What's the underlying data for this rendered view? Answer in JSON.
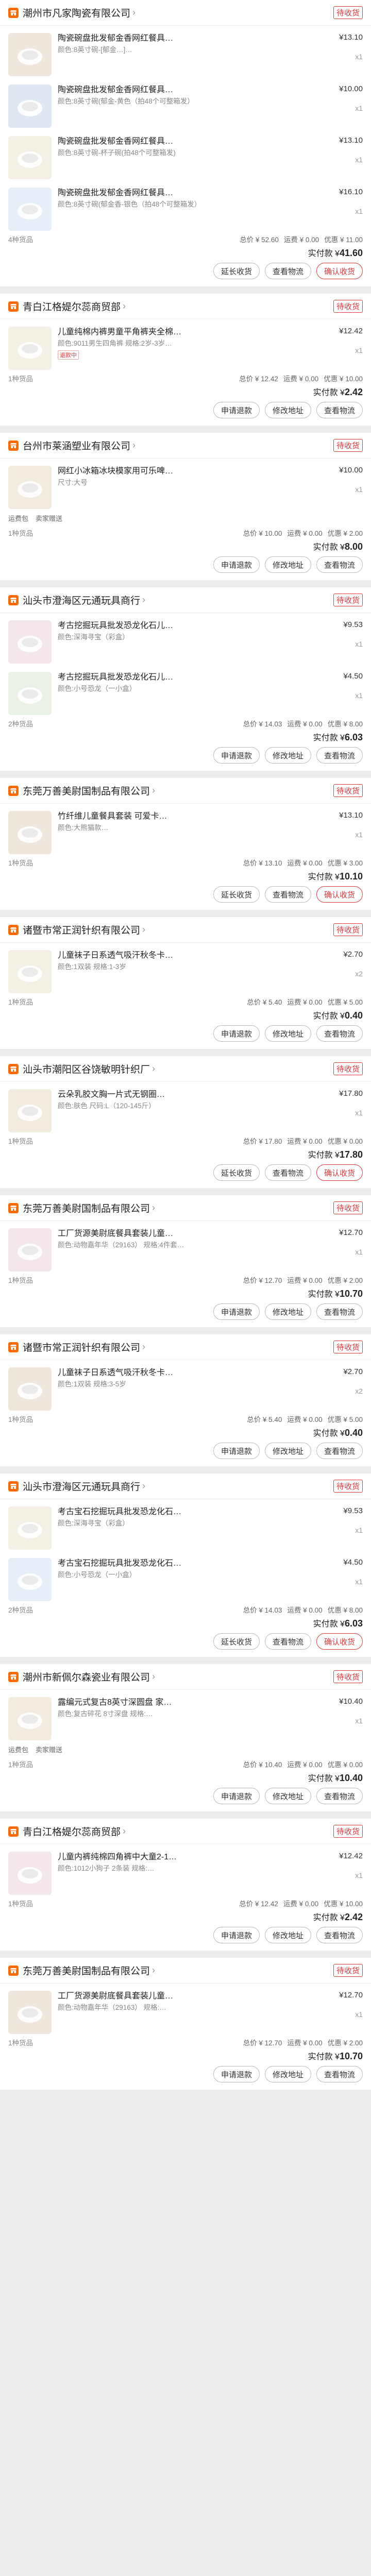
{
  "orders": [
    {
      "shop": "潮州市凡家陶瓷有限公司",
      "status": "待收货",
      "items": [
        {
          "title": "陶瓷碗盘批发郁金香网红餐具…",
          "spec": "颜色:8英寸碗-[郁金…]…",
          "price": "¥13.10",
          "qty": "x1"
        },
        {
          "title": "陶瓷碗盘批发郁金香网红餐具…",
          "spec": "颜色:8英寸碗(郁金-黄色（拍48个可整箱发）",
          "price": "¥10.00",
          "qty": "x1"
        },
        {
          "title": "陶瓷碗盘批发郁金香网红餐具…",
          "spec": "颜色:8英寸碗-杯子碗(拍48个可整箱发)",
          "price": "¥13.10",
          "qty": "x1"
        },
        {
          "title": "陶瓷碗盘批发郁金香网红餐具…",
          "spec": "颜色:8英寸碗(郁金香-银色（拍48个可整箱发）",
          "price": "¥16.10",
          "qty": "x1"
        }
      ],
      "count": "4种货品",
      "total": "总价 ¥ 52.60",
      "ship": "运费 ¥ 0.00",
      "discount": "优惠 ¥ 11.00",
      "paid_label": "实付款 ¥",
      "paid": "41.60",
      "buttons": [
        "延长收货",
        "查看物流",
        "确认收货"
      ]
    },
    {
      "shop": "青白江格媞尔蕊商贸部",
      "status": "待收货",
      "items": [
        {
          "title": "儿童纯棉内裤男童平角裤夹全棉…",
          "spec": "颜色:9011男生四角裤 规格:2岁-3岁…",
          "price": "¥12.42",
          "qty": "x1",
          "tag": "退款中"
        }
      ],
      "count": "1种货品",
      "total": "总价 ¥ 12.42",
      "ship": "运费 ¥ 0.00",
      "discount": "优惠 ¥ 10.00",
      "paid_label": "实付款 ¥",
      "paid": "2.42",
      "buttons": [
        "申请退款",
        "修改地址",
        "查看物流"
      ]
    },
    {
      "shop": "台州市莱涵塑业有限公司",
      "status": "待收货",
      "items": [
        {
          "title": "网红小冰箱冰块模家用可乐啤…",
          "spec": "尺寸:大号",
          "price": "¥10.00",
          "qty": "x1"
        }
      ],
      "note": [
        "运费包",
        "卖家赠送"
      ],
      "count": "1种货品",
      "total": "总价 ¥ 10.00",
      "ship": "运费 ¥ 0.00",
      "discount": "优惠 ¥ 2.00",
      "paid_label": "实付款 ¥",
      "paid": "8.00",
      "buttons": [
        "申请退款",
        "修改地址",
        "查看物流"
      ]
    },
    {
      "shop": "汕头市澄海区元通玩具商行",
      "status": "待收货",
      "items": [
        {
          "title": "考古挖掘玩具批发恐龙化石儿…",
          "spec": "颜色:深海寻宝（彩盒）",
          "price": "¥9.53",
          "qty": "x1"
        },
        {
          "title": "考古挖掘玩具批发恐龙化石儿…",
          "spec": "颜色:小号恐龙（一小盒）",
          "price": "¥4.50",
          "qty": "x1"
        }
      ],
      "count": "2种货品",
      "total": "总价 ¥ 14.03",
      "ship": "运费 ¥ 0.00",
      "discount": "优惠 ¥ 8.00",
      "paid_label": "实付款 ¥",
      "paid": "6.03",
      "buttons": [
        "申请退款",
        "修改地址",
        "查看物流"
      ]
    },
    {
      "shop": "东莞万善美尉国制品有限公司",
      "status": "待收货",
      "items": [
        {
          "title": "竹纤维儿童餐具套装 可爱卡…",
          "spec": "颜色:大熊猫款…",
          "price": "¥13.10",
          "qty": "x1"
        }
      ],
      "count": "1种货品",
      "total": "总价 ¥ 13.10",
      "ship": "运费 ¥ 0.00",
      "discount": "优惠 ¥ 3.00",
      "paid_label": "实付款 ¥",
      "paid": "10.10",
      "buttons": [
        "延长收货",
        "查看物流",
        "确认收货"
      ]
    },
    {
      "shop": "诸暨市常正润针织有限公司",
      "status": "待收货",
      "items": [
        {
          "title": "儿童袜子日系透气吸汗秋冬卡…",
          "spec": "颜色:1双装 规格:1-3岁",
          "price": "¥2.70",
          "qty": "x2"
        }
      ],
      "count": "1种货品",
      "total": "总价 ¥ 5.40",
      "ship": "运费 ¥ 0.00",
      "discount": "优惠 ¥ 5.00",
      "paid_label": "实付款 ¥",
      "paid": "0.40",
      "buttons": [
        "申请退款",
        "修改地址",
        "查看物流"
      ]
    },
    {
      "shop": "汕头市潮阳区谷饶敏明针织厂",
      "status": "待收货",
      "items": [
        {
          "title": "云朵乳胶文胸一片式无钢圈…",
          "spec": "颜色:肤色 尺码:L（120-145斤）",
          "price": "¥17.80",
          "qty": "x1"
        }
      ],
      "count": "1种货品",
      "total": "总价 ¥ 17.80",
      "ship": "运费 ¥ 0.00",
      "discount": "优惠 ¥ 0.00",
      "paid_label": "实付款 ¥",
      "paid": "17.80",
      "buttons": [
        "延长收货",
        "查看物流",
        "确认收货"
      ]
    },
    {
      "shop": "东莞万善美尉国制品有限公司",
      "status": "待收货",
      "items": [
        {
          "title": "工厂货源美尉底餐具套装儿童…",
          "spec": "颜色:动物嘉年华（29163） 规格:4件套…",
          "price": "¥12.70",
          "qty": "x1"
        }
      ],
      "count": "1种货品",
      "total": "总价 ¥ 12.70",
      "ship": "运费 ¥ 0.00",
      "discount": "优惠 ¥ 2.00",
      "paid_label": "实付款 ¥",
      "paid": "10.70",
      "buttons": [
        "申请退款",
        "修改地址",
        "查看物流"
      ]
    },
    {
      "shop": "诸暨市常正润针织有限公司",
      "status": "待收货",
      "items": [
        {
          "title": "儿童袜子日系透气吸汗秋冬卡…",
          "spec": "颜色:1双装 规格:3-5岁",
          "price": "¥2.70",
          "qty": "x2"
        }
      ],
      "count": "1种货品",
      "total": "总价 ¥ 5.40",
      "ship": "运费 ¥ 0.00",
      "discount": "优惠 ¥ 5.00",
      "paid_label": "实付款 ¥",
      "paid": "0.40",
      "buttons": [
        "申请退款",
        "修改地址",
        "查看物流"
      ]
    },
    {
      "shop": "汕头市澄海区元通玩具商行",
      "status": "待收货",
      "items": [
        {
          "title": "考古宝石挖掘玩具批发恐龙化石…",
          "spec": "颜色:深海寻宝（彩盒）",
          "price": "¥9.53",
          "qty": "x1"
        },
        {
          "title": "考古宝石挖掘玩具批发恐龙化石…",
          "spec": "颜色:小号恐龙（一小盒）",
          "price": "¥4.50",
          "qty": "x1"
        }
      ],
      "count": "2种货品",
      "total": "总价 ¥ 14.03",
      "ship": "运费 ¥ 0.00",
      "discount": "优惠 ¥ 8.00",
      "paid_label": "实付款 ¥",
      "paid": "6.03",
      "buttons": [
        "延长收货",
        "查看物流",
        "确认收货"
      ]
    },
    {
      "shop": "潮州市新佩尔森瓷业有限公司",
      "status": "待收货",
      "items": [
        {
          "title": "露编元式复古8英寸深圆盘 家…",
          "spec": "颜色:复古碎花 8寸深盘 规格:…",
          "price": "¥10.40",
          "qty": "x1"
        }
      ],
      "note": [
        "运费包",
        "卖家赠送"
      ],
      "count": "1种货品",
      "total": "总价 ¥ 10.40",
      "ship": "运费 ¥ 0.00",
      "discount": "优惠 ¥ 0.00",
      "paid_label": "实付款 ¥",
      "paid": "10.40",
      "buttons": [
        "申请退款",
        "修改地址",
        "查看物流"
      ]
    },
    {
      "shop": "青白江格媞尔蕊商贸部",
      "status": "待收货",
      "items": [
        {
          "title": "儿童内裤纯棉四角裤中大童2-1…",
          "spec": "颜色:1012小狗子 2条装 规格:…",
          "price": "¥12.42",
          "qty": "x1"
        }
      ],
      "count": "1种货品",
      "total": "总价 ¥ 12.42",
      "ship": "运费 ¥ 0.00",
      "discount": "优惠 ¥ 10.00",
      "paid_label": "实付款 ¥",
      "paid": "2.42",
      "buttons": [
        "申请退款",
        "修改地址",
        "查看物流"
      ]
    },
    {
      "shop": "东莞万善美尉国制品有限公司",
      "status": "待收货",
      "items": [
        {
          "title": "工厂货源美尉底餐具套装儿童…",
          "spec": "颜色:动物嘉年华（29163） 规格:…",
          "price": "¥12.70",
          "qty": "x1"
        }
      ],
      "count": "1种货品",
      "total": "总价 ¥ 12.70",
      "ship": "运费 ¥ 0.00",
      "discount": "优惠 ¥ 2.00",
      "paid_label": "实付款 ¥",
      "paid": "10.70",
      "buttons": [
        "申请退款",
        "修改地址",
        "查看物流"
      ]
    }
  ],
  "colors": {
    "accent": "#e4393c",
    "shop_icon": "#ff6a00",
    "bg": "#ececec"
  },
  "icons": {
    "shop": "store-icon",
    "chevron": "chevron-right-icon"
  }
}
